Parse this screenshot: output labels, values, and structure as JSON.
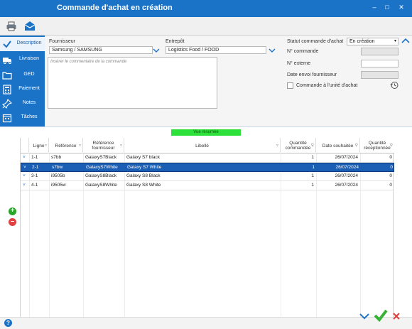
{
  "window": {
    "title": "Commande d'achat en création",
    "controls": [
      "minimize",
      "maximize",
      "close"
    ]
  },
  "toolbar": {
    "icons": [
      "printer-icon",
      "envelope-icon"
    ]
  },
  "sidebar": {
    "items": [
      {
        "label": "Description",
        "icon": "check-icon",
        "active": true
      },
      {
        "label": "Livraison",
        "icon": "truck-icon",
        "active": false
      },
      {
        "label": "GED",
        "icon": "folder-icon",
        "active": false
      },
      {
        "label": "Paiement",
        "icon": "calculator-icon",
        "active": false
      },
      {
        "label": "Notes",
        "icon": "pin-icon",
        "active": false
      },
      {
        "label": "Tâches",
        "icon": "calendar-icon",
        "active": false
      }
    ]
  },
  "form": {
    "supplier_label": "Fournisseur",
    "supplier_value": "Samsung / SAMSUNG",
    "warehouse_label": "Entrepôt",
    "warehouse_value": "Logistics Food / FOOD",
    "comment_placeholder": "Insérer le commentaire de la commande",
    "status_label": "Statut commande d'achat",
    "status_value": "En création",
    "order_number_label": "N° commande",
    "order_number_value": "",
    "external_number_label": "N° externe",
    "external_number_value": "",
    "send_date_label": "Date envoi fournisseur",
    "send_date_value": "",
    "unit_order_label": "Commande à l'unité d'achat",
    "unit_order_checked": false
  },
  "grid": {
    "summary_label": "Vue résumée",
    "columns": [
      "Ligne",
      "Référence",
      "Référence fournisseur",
      "Libellé",
      "Quantité commandée",
      "Date souhaitée",
      "Quantité réceptionnée"
    ],
    "rows": [
      {
        "ligne": "1-1",
        "ref": "s7bb",
        "ref_fournisseur": "GalaxyS7Black",
        "libelle": "Galaxy S7 black",
        "qte_commandee": "1",
        "date": "26/07/2024",
        "qte_recue": "0",
        "selected": false
      },
      {
        "ligne": "2-1",
        "ref": "s7bw",
        "ref_fournisseur": "GalaxyS7White",
        "libelle": "Galaxy S7 White",
        "qte_commandee": "1",
        "date": "26/07/2024",
        "qte_recue": "0",
        "selected": true
      },
      {
        "ligne": "3-1",
        "ref": "i9505b",
        "ref_fournisseur": "GalaxyS8Black",
        "libelle": "Galaxy S8 Black",
        "qte_commandee": "1",
        "date": "26/07/2024",
        "qte_recue": "0",
        "selected": false
      },
      {
        "ligne": "4-1",
        "ref": "i9505w",
        "ref_fournisseur": "GalaxyS8White",
        "libelle": "Galaxy S8 White",
        "qte_commandee": "1",
        "date": "26/07/2024",
        "qte_recue": "0",
        "selected": false
      }
    ]
  },
  "colors": {
    "primary": "#1b73c8",
    "selection": "#1b5fb5",
    "summary_bar": "#2de03a",
    "add": "#2aa52a",
    "remove": "#e04040",
    "confirm": "#36b336",
    "cancel": "#e03a3a"
  }
}
